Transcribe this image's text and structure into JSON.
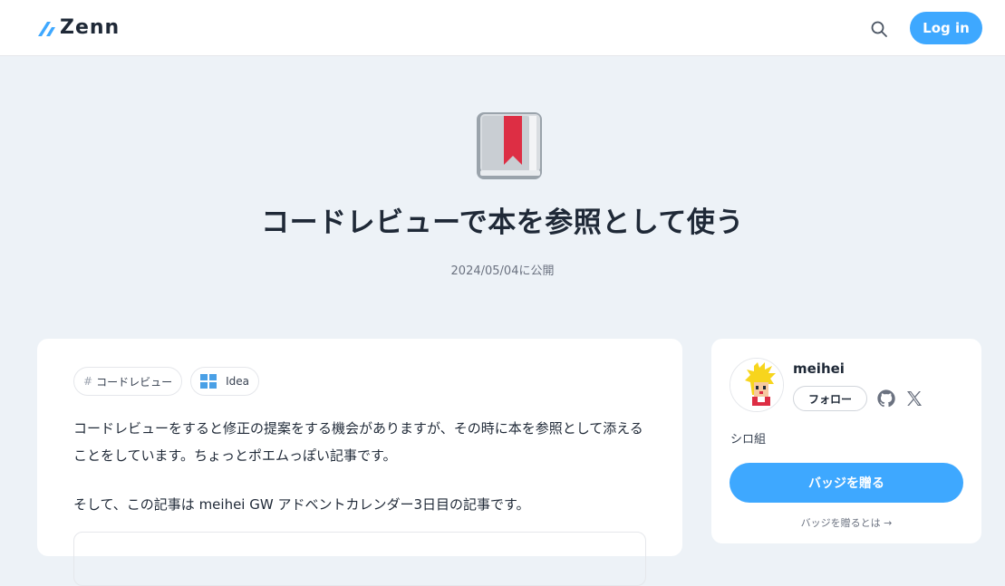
{
  "header": {
    "logo_text": "Zenn",
    "login_label": "Log in",
    "accent_color": "#3ea8ff"
  },
  "article": {
    "emoji": "bookmark-book-icon",
    "title": "コードレビューで本を参照として使う",
    "published": "2024/05/04に公開",
    "topics": [
      {
        "hash": "#",
        "label": "コードレビュー"
      },
      {
        "icon": "windows-grid-icon",
        "label": "Idea"
      }
    ],
    "body": [
      "コードレビューをすると修正の提案をする機会がありますが、その時に本を参照として添えることをしています。ちょっとポエムっぽい記事です。",
      "そして、この記事は meihei GW アドベントカレンダー3日目の記事です。"
    ]
  },
  "author": {
    "name": "meihei",
    "follow_label": "フォロー",
    "bio": "シロ組",
    "badge_label": "バッジを贈る",
    "badge_help": "バッジを贈るとは →"
  }
}
